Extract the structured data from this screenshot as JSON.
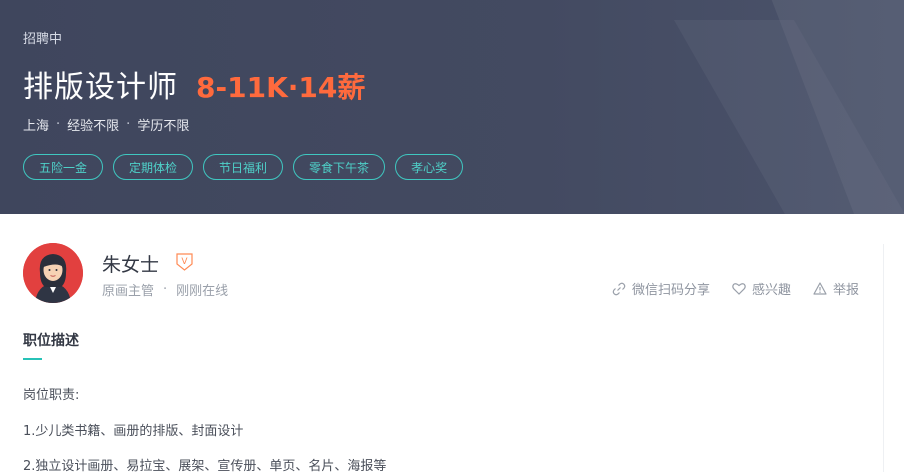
{
  "job": {
    "status": "招聘中",
    "title": "排版设计师",
    "salary": "8-11K·14薪",
    "city": "上海",
    "experience": "经验不限",
    "education": "学历不限",
    "meta_separator": "·",
    "benefits": [
      "五险一金",
      "定期体检",
      "节日福利",
      "零食下午茶",
      "孝心奖"
    ]
  },
  "recruiter": {
    "name": "朱女士",
    "verify_badge": "V",
    "title": "原画主管",
    "separator": "·",
    "online_status": "刚刚在线"
  },
  "actions": {
    "share": "微信扫码分享",
    "interest": "感兴趣",
    "report": "举报"
  },
  "description": {
    "section_title": "职位描述",
    "lines": [
      "岗位职责:",
      "1.少儿类书籍、画册的排版、封面设计",
      "2.独立设计画册、易拉宝、展架、宣传册、单页、名片、海报等"
    ]
  },
  "colors": {
    "hero_bg": "#434a61",
    "salary": "#ff6a3d",
    "tag_border": "#3fc7c0",
    "accent": "#27c2b7"
  },
  "icons": [
    "link-icon",
    "heart-icon",
    "warning-icon",
    "verified-icon"
  ]
}
